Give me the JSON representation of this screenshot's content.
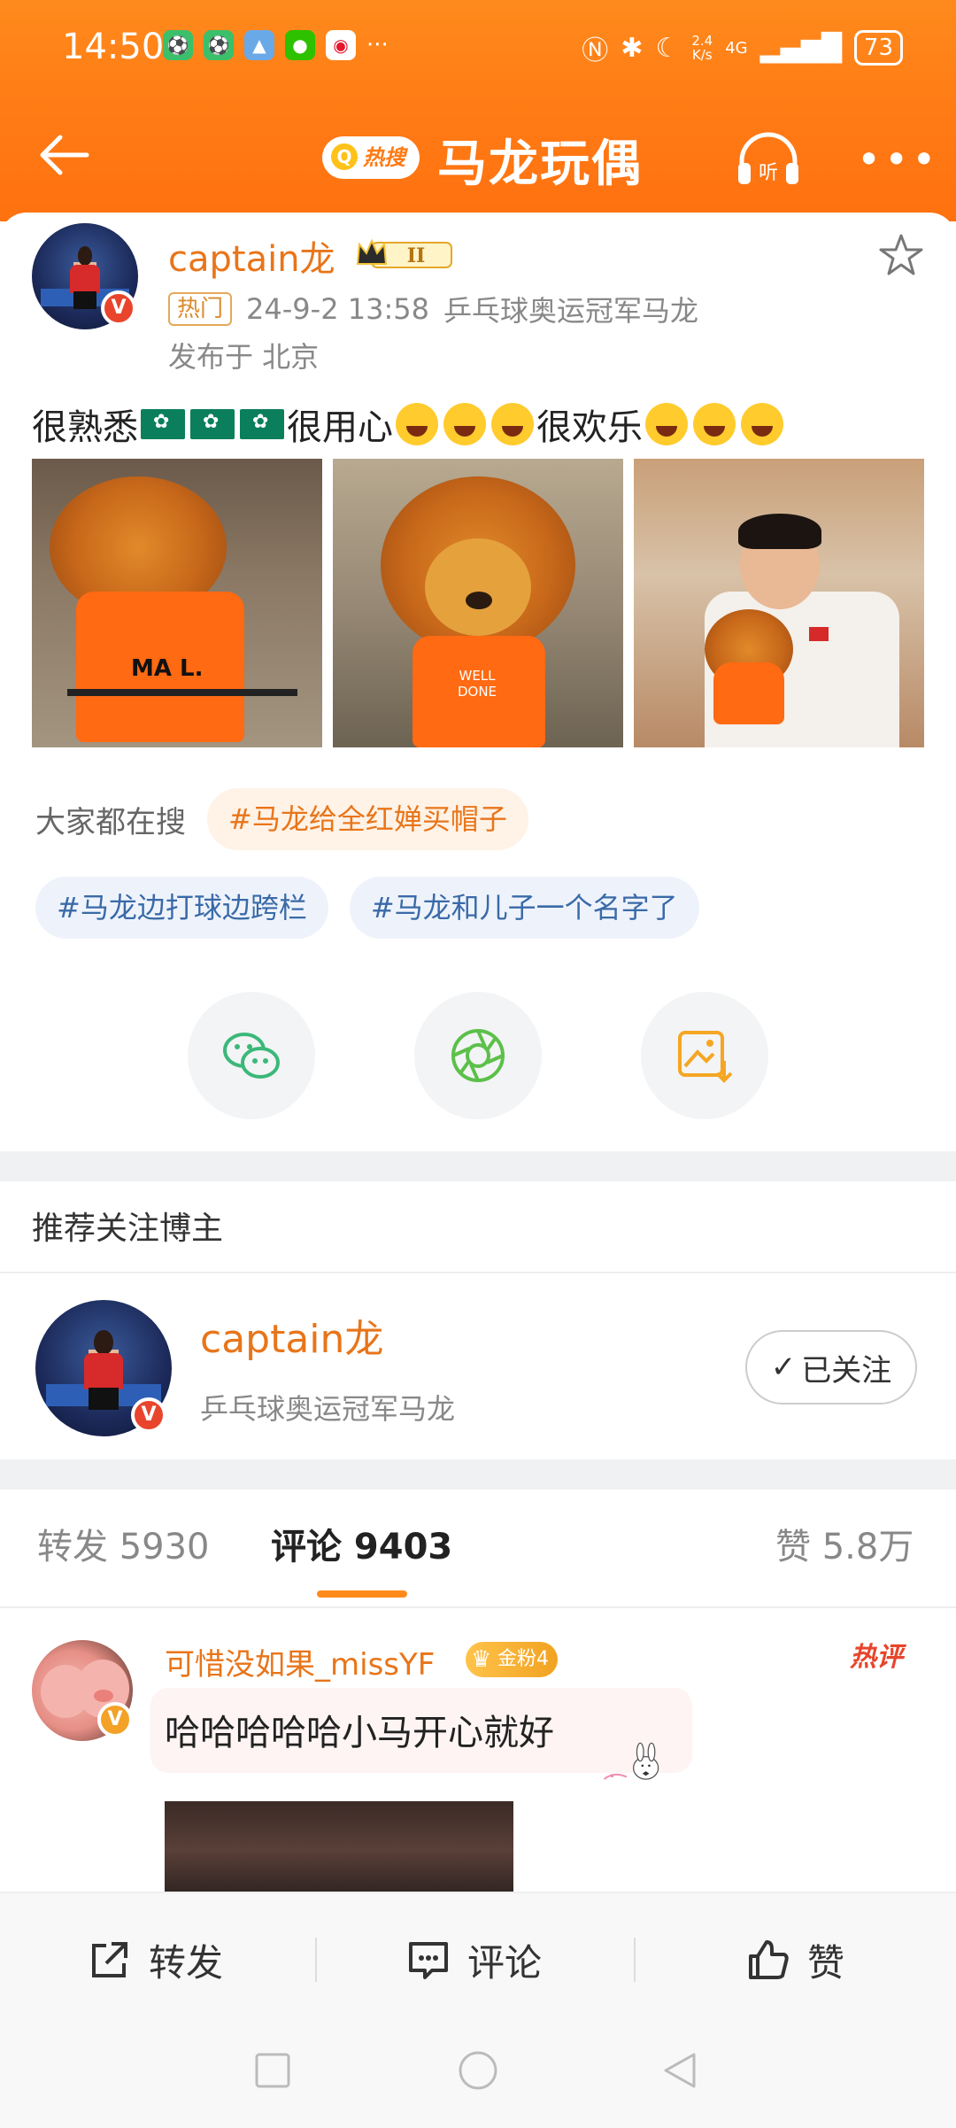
{
  "status_bar": {
    "time": "14:50",
    "network": "4G",
    "speed_top": "2.4",
    "speed_unit": "K/s",
    "battery": "73"
  },
  "nav": {
    "hot_search_label": "热搜",
    "title": "马龙玩偶",
    "listen_label": "听"
  },
  "post": {
    "author": "captain龙",
    "level_badge": "II",
    "hot_tag": "热门",
    "datetime": "24-9-2 13:58",
    "author_desc": "乒乓球奥运冠军马龙",
    "location": "发布于 北京",
    "text_parts": [
      "很熟悉",
      "很用心",
      "很欢乐"
    ],
    "photo1_text": "MA L.",
    "photo2_text": "WELL DONE"
  },
  "search": {
    "label": "大家都在搜",
    "chips": [
      "#马龙给全红婵买帽子",
      "#马龙边打球边跨栏",
      "#马龙和儿子一个名字了"
    ]
  },
  "recommend": {
    "title": "推荐关注博主",
    "name": "captain龙",
    "desc": "乒乓球奥运冠军马龙",
    "follow_label": "已关注"
  },
  "tabs": {
    "repost": "转发 5930",
    "comment": "评论 9403",
    "like": "赞 5.8万"
  },
  "comment": {
    "user": "可惜没如果_missYF",
    "fan_badge": "金粉4",
    "hot_label": "热评",
    "text": "哈哈哈哈哈小马开心就好"
  },
  "bottom_bar": {
    "repost": "转发",
    "comment": "评论",
    "like": "赞"
  },
  "colors": {
    "accent": "#ff7a14",
    "name_orange": "#e8751a",
    "tag_blue": "#3a6aa8"
  }
}
